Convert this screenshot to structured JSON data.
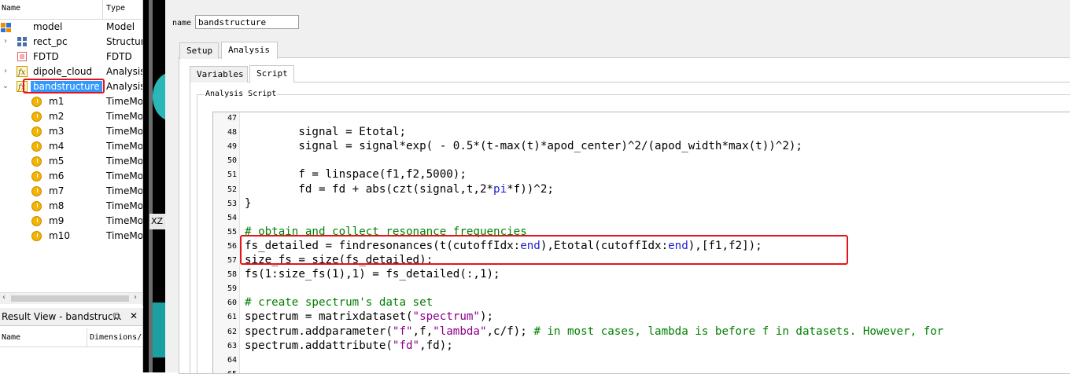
{
  "tree": {
    "header": {
      "name": "Name",
      "type": "Type"
    },
    "items": [
      {
        "name": "model",
        "type": "Model",
        "icon": "model-icon",
        "expander": ""
      },
      {
        "name": "rect_pc",
        "type": "Structur",
        "icon": "structure-group-icon",
        "expander": "›"
      },
      {
        "name": "FDTD",
        "type": "FDTD",
        "icon": "fdtd-icon",
        "expander": ""
      },
      {
        "name": "dipole_cloud",
        "type": "Analysis",
        "icon": "analysis-fx-icon",
        "expander": "›"
      },
      {
        "name": "bandstructure",
        "type": "Analysis",
        "icon": "analysis-fx-icon",
        "expander": "⌄"
      },
      {
        "name": "m1",
        "type": "TimeMo",
        "icon": "time-monitor-icon"
      },
      {
        "name": "m2",
        "type": "TimeMo",
        "icon": "time-monitor-icon"
      },
      {
        "name": "m3",
        "type": "TimeMo",
        "icon": "time-monitor-icon"
      },
      {
        "name": "m4",
        "type": "TimeMo",
        "icon": "time-monitor-icon"
      },
      {
        "name": "m5",
        "type": "TimeMo",
        "icon": "time-monitor-icon"
      },
      {
        "name": "m6",
        "type": "TimeMo",
        "icon": "time-monitor-icon"
      },
      {
        "name": "m7",
        "type": "TimeMo",
        "icon": "time-monitor-icon"
      },
      {
        "name": "m8",
        "type": "TimeMo",
        "icon": "time-monitor-icon"
      },
      {
        "name": "m9",
        "type": "TimeMo",
        "icon": "time-monitor-icon"
      },
      {
        "name": "m10",
        "type": "TimeMo",
        "icon": "time-monitor-icon"
      }
    ],
    "selected": "bandstructure",
    "scroll_left": "‹",
    "scroll_right": "›"
  },
  "result_view": {
    "title": "Result View - bandstruc...",
    "restore": "⧉",
    "close": "✕",
    "columns": [
      "Name",
      "Dimensions/"
    ]
  },
  "viewport": {
    "label": "XZ"
  },
  "editor": {
    "name_label": "name",
    "name_value": "bandstructure",
    "tabs": [
      "Setup",
      "Analysis"
    ],
    "active_tab": "Analysis",
    "subtabs": [
      "Variables",
      "Script"
    ],
    "active_subtab": "Script",
    "group_label": "Analysis Script"
  },
  "code_lines": [
    {
      "n": "47",
      "text": ""
    },
    {
      "n": "48",
      "text": "        signal = Etotal;"
    },
    {
      "n": "49",
      "text": "        signal = signal*exp( - 0.5*(t-max(t)*apod_center)^2/(apod_width*max(t))^2);"
    },
    {
      "n": "50",
      "text": ""
    },
    {
      "n": "51",
      "text": "        f = linspace(f1,f2,5000);"
    },
    {
      "n": "52",
      "text": "        fd = fd + abs(czt(signal,t,2*pi*f))^2;"
    },
    {
      "n": "53",
      "text": "}"
    },
    {
      "n": "54",
      "text": ""
    },
    {
      "n": "55",
      "text": "# obtain and collect resonance frequencies"
    },
    {
      "n": "56",
      "text": "fs_detailed = findresonances(t(cutoffIdx:end),Etotal(cutoffIdx:end),[f1,f2]);"
    },
    {
      "n": "57",
      "text": "size_fs = size(fs_detailed);"
    },
    {
      "n": "58",
      "text": "fs(1:size_fs(1),1) = fs_detailed(:,1);"
    },
    {
      "n": "59",
      "text": ""
    },
    {
      "n": "60",
      "text": "# create spectrum's data set"
    },
    {
      "n": "61",
      "text": "spectrum = matrixdataset(\"spectrum\");"
    },
    {
      "n": "62",
      "text": "spectrum.addparameter(\"f\",f,\"lambda\",c/f); # in most cases, lambda is before f in datasets. However, for"
    },
    {
      "n": "63",
      "text": "spectrum.addattribute(\"fd\",fd);"
    },
    {
      "n": "64",
      "text": ""
    },
    {
      "n": "65",
      "text": ""
    }
  ],
  "colors": {
    "highlight": "#e4141b",
    "selection": "#3399ff",
    "keyword": "#1f1fd0",
    "string": "#8a008a",
    "comment": "#008000",
    "viewport_teal": "#2ab7b7"
  }
}
